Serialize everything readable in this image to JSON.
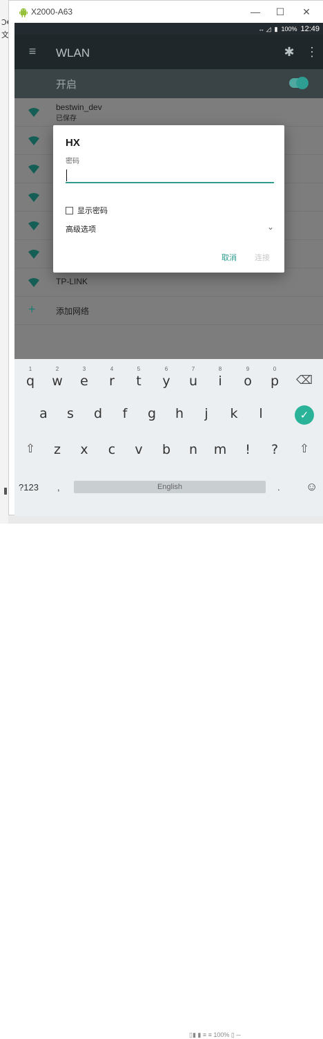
{
  "window": {
    "title": "X2000-A63",
    "minimize": "—",
    "maximize": "☐",
    "close": "✕"
  },
  "background_text": {
    "frag1": "Ͻ€",
    "frag2": "文",
    "bottom": "▯▮ ▮ ≡ ≡  100%  ▯ ─"
  },
  "statusbar": {
    "signal": "↔ ◿",
    "battery": "▮",
    "battery_pct": "100%",
    "time": "12:49"
  },
  "appbar": {
    "title": "WLAN",
    "menu_icon": "≡",
    "gear_icon": "✱",
    "more_icon": "⋮"
  },
  "toggle": {
    "label": "开启",
    "on": true
  },
  "networks": [
    {
      "name": "bestwin_dev",
      "status": "已保存"
    },
    {
      "name": "",
      "status": ""
    },
    {
      "name": "",
      "status": ""
    },
    {
      "name": "",
      "status": ""
    },
    {
      "name": "",
      "status": ""
    },
    {
      "name": "",
      "status": ""
    },
    {
      "name": "TP-LINK",
      "status": ""
    }
  ],
  "add_network": {
    "icon": "+",
    "label": "添加网络"
  },
  "dialog": {
    "title": "HX",
    "password_label": "密码",
    "password_value": "",
    "show_password_label": "显示密码",
    "advanced_label": "高级选项",
    "chevron": "⌄",
    "cancel_label": "取消",
    "connect_label": "连接"
  },
  "keyboard": {
    "row1": [
      {
        "key": "q",
        "hint": "1"
      },
      {
        "key": "w",
        "hint": "2"
      },
      {
        "key": "e",
        "hint": "3"
      },
      {
        "key": "r",
        "hint": "4"
      },
      {
        "key": "t",
        "hint": "5"
      },
      {
        "key": "y",
        "hint": "6"
      },
      {
        "key": "u",
        "hint": "7"
      },
      {
        "key": "i",
        "hint": "8"
      },
      {
        "key": "o",
        "hint": "9"
      },
      {
        "key": "p",
        "hint": "0"
      },
      {
        "key": "⌫",
        "hint": ""
      }
    ],
    "row2": [
      "a",
      "s",
      "d",
      "f",
      "g",
      "h",
      "j",
      "k",
      "l"
    ],
    "enter": "✓",
    "row3": [
      "⇧",
      "z",
      "x",
      "c",
      "v",
      "b",
      "n",
      "m",
      "!",
      "?",
      "⇧"
    ],
    "symbols": "?123",
    "comma": ",",
    "space_label": "English",
    "period": ".",
    "emoji": "☺"
  },
  "colors": {
    "accent": "#2f9b8e",
    "appbar": "#1f272b",
    "dim_list": "#7d7d7d"
  }
}
